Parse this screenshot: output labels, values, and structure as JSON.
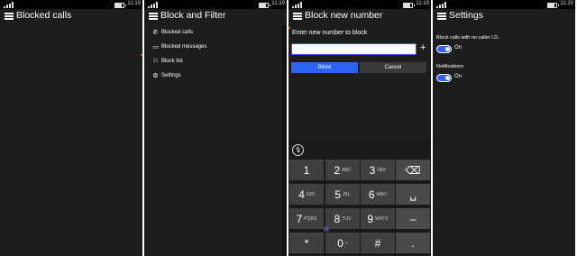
{
  "screens": [
    {
      "time": "11:19",
      "title": "Blocked calls"
    },
    {
      "time": "11:19",
      "title": "Block and Filter",
      "menu": [
        {
          "icon": "phone-icon",
          "glyph": "✆",
          "label": "Blocked calls"
        },
        {
          "icon": "message-icon",
          "glyph": "▭",
          "label": "Blocked messages"
        },
        {
          "icon": "block-list-icon",
          "glyph": "⚐",
          "label": "Block list"
        },
        {
          "icon": "gear-icon",
          "glyph": "⚙",
          "label": "Settings"
        }
      ]
    },
    {
      "time": "11:19",
      "title": "Block new number",
      "prompt": "Enter new number to block",
      "input_value": "",
      "add_glyph": "+",
      "block_label": "Block",
      "cancel_label": "Cancel",
      "mic_glyph": "🎙",
      "keys": [
        {
          "n": "1",
          "s": ""
        },
        {
          "n": "2",
          "s": "ABC"
        },
        {
          "n": "3",
          "s": "DEF"
        },
        {
          "n": "⌫",
          "s": "",
          "func": true
        },
        {
          "n": "4",
          "s": "GHI"
        },
        {
          "n": "5",
          "s": "JKL"
        },
        {
          "n": "6",
          "s": "MNO"
        },
        {
          "n": "␣",
          "s": "",
          "func": true
        },
        {
          "n": "7",
          "s": "PQRS"
        },
        {
          "n": "8",
          "s": "TUV"
        },
        {
          "n": "9",
          "s": "WXYZ"
        },
        {
          "n": "–",
          "s": "",
          "func": true
        },
        {
          "n": "*",
          "s": ""
        },
        {
          "n": "0",
          "s": "+"
        },
        {
          "n": "#",
          "s": ""
        },
        {
          "n": ".",
          "s": "",
          "func": true
        }
      ]
    },
    {
      "time": "11:20",
      "title": "Settings",
      "settings": [
        {
          "label": "Block calls with no caller I.D.",
          "state": "On"
        },
        {
          "label": "Notifications",
          "state": "On"
        }
      ]
    }
  ]
}
